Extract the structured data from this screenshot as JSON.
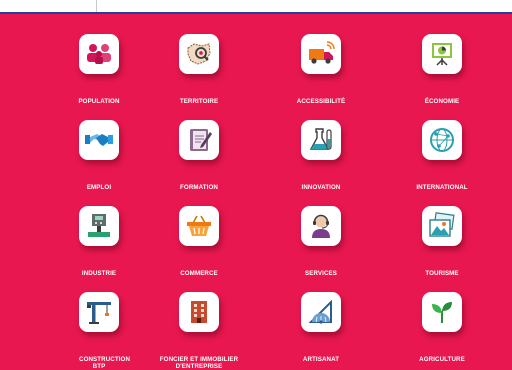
{
  "tiles": [
    {
      "label": "POPULATION",
      "icon": "population-icon"
    },
    {
      "label": "TERRITOIRE",
      "icon": "territory-map-icon"
    },
    {
      "label": "ACCESSIBILITÉ",
      "icon": "truck-icon"
    },
    {
      "label": "ÉCONOMIE",
      "icon": "presentation-chart-icon"
    },
    {
      "label": "EMPLOI",
      "icon": "handshake-icon"
    },
    {
      "label": "FORMATION",
      "icon": "notebook-pen-icon"
    },
    {
      "label": "INNOVATION",
      "icon": "lab-flask-icon"
    },
    {
      "label": "INTERNATIONAL",
      "icon": "globe-network-icon"
    },
    {
      "label": "INDUSTRIE",
      "icon": "industrial-machine-icon"
    },
    {
      "label": "COMMERCE",
      "icon": "shopping-basket-icon"
    },
    {
      "label": "SERVICES",
      "icon": "call-center-agent-icon"
    },
    {
      "label": "TOURISME",
      "icon": "landscape-photos-icon"
    },
    {
      "label": "CONSTRUCTION BTP",
      "icon": "crane-icon"
    },
    {
      "label": "FONCIER ET IMMOBILIER D'ENTREPRISE",
      "icon": "office-building-icon"
    },
    {
      "label": "ARTISANAT",
      "icon": "drafting-tools-icon"
    },
    {
      "label": "AGRICULTURE",
      "icon": "sprout-icon"
    }
  ],
  "colors": {
    "background": "#e8174f",
    "tile": "#ffffff",
    "topbar_accent": "#2a3c9b"
  }
}
